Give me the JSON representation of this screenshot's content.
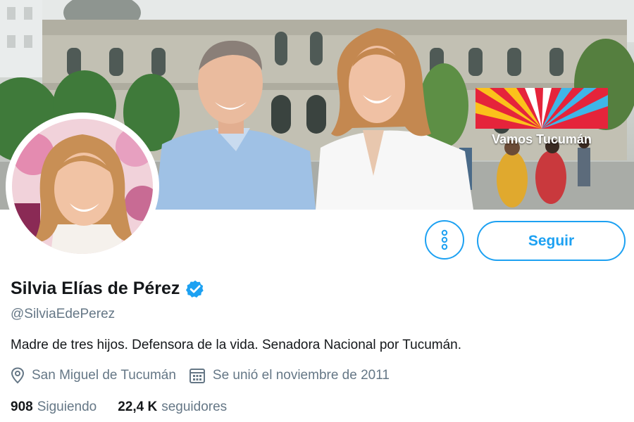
{
  "banner": {
    "logo_caption": "Vamos Tucumán",
    "logo_stripe_colors": [
      "#e5243b",
      "#fbc21b",
      "#ffffff",
      "#3fb6e8"
    ]
  },
  "profile": {
    "display_name": "Silvia Elías de Pérez",
    "handle": "@SilviaEdePerez",
    "verified": true,
    "bio": "Madre de tres hijos. Defensora de la vida. Senadora Nacional por Tucumán.",
    "location": "San Miguel de Tucumán",
    "joined": "Se unió el noviembre de 2011",
    "following_count": "908",
    "following_label": "Siguiendo",
    "followers_count": "22,4 K",
    "followers_label": "seguidores"
  },
  "actions": {
    "follow_label": "Seguir",
    "more_icon": "more-options-icon"
  },
  "icons": {
    "verified": "verified-badge-icon",
    "location": "location-pin-icon",
    "calendar": "calendar-icon"
  },
  "colors": {
    "accent": "#1da1f2",
    "text_primary": "#14171a",
    "text_secondary": "#657786"
  }
}
